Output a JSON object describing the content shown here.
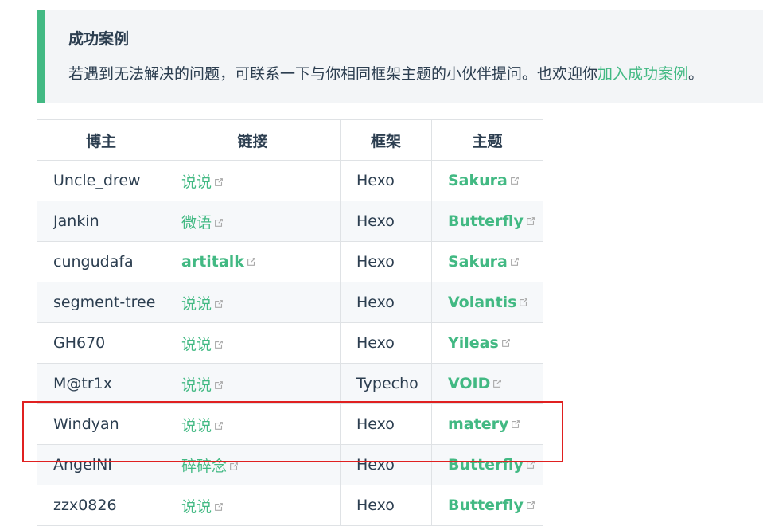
{
  "tip": {
    "title": "成功案例",
    "body_prefix": "若遇到无法解决的问题，可联系一下与你相同框架主题的小伙伴提问。也欢迎你",
    "body_link": "加入成功案例",
    "body_suffix": "。"
  },
  "table": {
    "headers": [
      "博主",
      "链接",
      "框架",
      "主题"
    ],
    "rows": [
      {
        "blogger": "Uncle_drew",
        "link": "说说",
        "link_bold": false,
        "framework": "Hexo",
        "theme": "Sakura"
      },
      {
        "blogger": "Jankin",
        "link": "微语",
        "link_bold": false,
        "framework": "Hexo",
        "theme": "Butterfly"
      },
      {
        "blogger": "cungudafa",
        "link": "artitalk",
        "link_bold": true,
        "framework": "Hexo",
        "theme": "Sakura"
      },
      {
        "blogger": "segment-tree",
        "link": "说说",
        "link_bold": false,
        "framework": "Hexo",
        "theme": "Volantis"
      },
      {
        "blogger": "GH670",
        "link": "说说",
        "link_bold": false,
        "framework": "Hexo",
        "theme": "Yileas"
      },
      {
        "blogger": "M@tr1x",
        "link": "说说",
        "link_bold": false,
        "framework": "Typecho",
        "theme": "VOID"
      },
      {
        "blogger": "Windyan",
        "link": "说说",
        "link_bold": false,
        "framework": "Hexo",
        "theme": "matery"
      },
      {
        "blogger": "AngelNI",
        "link": "碎碎念",
        "link_bold": false,
        "framework": "Hexo",
        "theme": "Butterfly"
      },
      {
        "blogger": "zzx0826",
        "link": "说说",
        "link_bold": false,
        "framework": "Hexo",
        "theme": "Butterfly"
      }
    ]
  },
  "colors": {
    "accent": "#42b983",
    "text": "#2c3e50",
    "highlight_border": "#e02020"
  },
  "icons": {
    "external_link": "external-link-icon"
  }
}
